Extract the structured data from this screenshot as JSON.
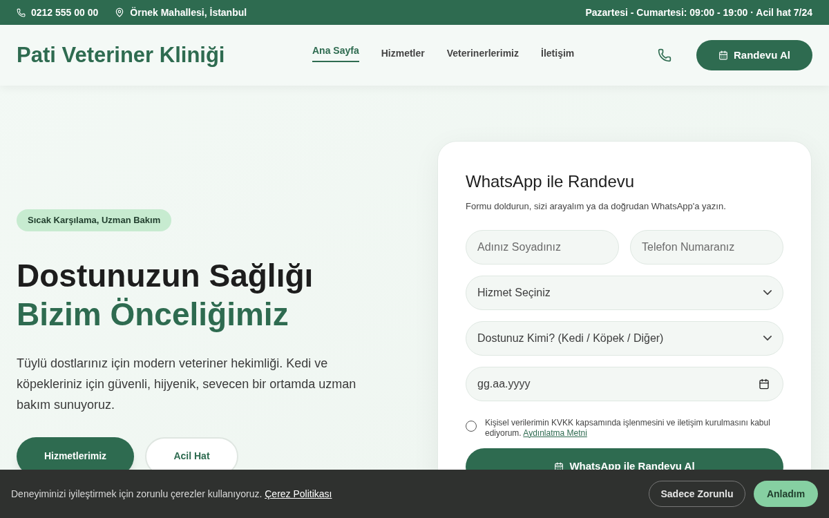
{
  "topbar": {
    "phone": "0212 555 00 00",
    "address": "Örnek Mahallesi, İstanbul",
    "hours": "Pazartesi - Cumartesi: 09:00 - 19:00 · Acil hat 7/24"
  },
  "header": {
    "logo": "Pati Veteriner Kliniği",
    "nav": [
      {
        "label": "Ana Sayfa",
        "selected": true
      },
      {
        "label": "Hizmetler",
        "selected": false
      },
      {
        "label": "Veterinerlerimiz",
        "selected": false
      },
      {
        "label": "İletişim",
        "selected": false
      }
    ],
    "cta": "Randevu Al"
  },
  "hero": {
    "badge": "Sıcak Karşılama, Uzman Bakım",
    "title_line1": "Dostunuzun Sağlığı",
    "title_line2": "Bizim Önceliğimiz",
    "text": "Tüylü dostlarınız için modern veteriner hekimliği. Kedi ve köpekleriniz için güvenli, hijyenik, sevecen bir ortamda uzman bakım sunuyoruz.",
    "buttons": [
      {
        "label": "Hizmetlerimiz",
        "kind": "primary"
      },
      {
        "label": "Acil Hat",
        "kind": "outline"
      }
    ]
  },
  "form": {
    "title": "WhatsApp ile Randevu",
    "subtitle": "Formu doldurun, sizi arayalım ya da doğrudan WhatsApp'a yazın.",
    "fields": [
      {
        "kind": "text",
        "placeholder": "Adınız Soyadınız"
      },
      {
        "kind": "text",
        "placeholder": "Telefon Numaranız"
      },
      {
        "kind": "select",
        "value": "Hizmet Seçiniz"
      },
      {
        "kind": "select",
        "value": "Dostunuz Kimi? (Kedi / Köpek / Diğer)"
      },
      {
        "kind": "date",
        "placeholder": "gg.aa.yyyy"
      }
    ],
    "consent": {
      "checked": false,
      "text": "Kişisel verilerimin KVKK kapsamında işlenmesini ve iletişim kurulmasını kabul ediyorum.",
      "link": "Aydınlatma Metni"
    },
    "submit": "WhatsApp ile Randevu Al"
  },
  "cookie_bar": {
    "text": "Deneyiminizi iyileştirmek için zorunlu çerezler kullanıyoruz.",
    "link": "Çerez Politikası",
    "buttons": [
      {
        "label": "Sadece Zorunlu",
        "kind": "outline"
      },
      {
        "label": "Anladım",
        "kind": "primary"
      }
    ]
  }
}
